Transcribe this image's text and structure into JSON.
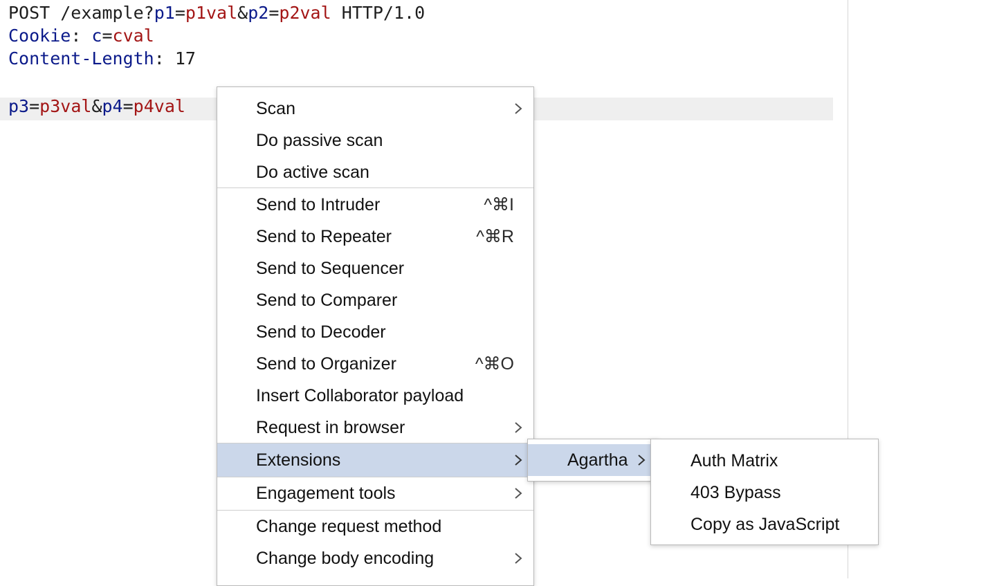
{
  "editor": {
    "request_line": {
      "method_path": "POST /example?",
      "p1_key": "p1",
      "eq1": "=",
      "p1_val": "p1val",
      "amp1": "&",
      "p2_key": "p2",
      "eq2": "=",
      "p2_val": "p2val",
      "protocol": " HTTP/1.0"
    },
    "cookie_line": {
      "name": "Cookie",
      "sep": ": ",
      "key": "c",
      "eq": "=",
      "val": "cval"
    },
    "content_length_line": {
      "name": "Content-Length",
      "sep": ": ",
      "val": "17"
    },
    "body_line": {
      "p3_key": "p3",
      "eq1": "=",
      "p3_val": "p3val",
      "amp": "&",
      "p4_key": "p4",
      "eq2": "=",
      "p4_val": "p4val"
    }
  },
  "context_menu": {
    "items": [
      {
        "label": "Scan",
        "submenu": true
      },
      {
        "label": "Do passive scan"
      },
      {
        "label": "Do active scan"
      },
      {
        "label": "Send to Intruder",
        "shortcut": "^⌘I"
      },
      {
        "label": "Send to Repeater",
        "shortcut": "^⌘R"
      },
      {
        "label": "Send to Sequencer"
      },
      {
        "label": "Send to Comparer"
      },
      {
        "label": "Send to Decoder"
      },
      {
        "label": "Send to Organizer",
        "shortcut": "^⌘O"
      },
      {
        "label": "Insert Collaborator payload"
      },
      {
        "label": "Request in browser",
        "submenu": true
      },
      {
        "label": "Extensions",
        "submenu": true,
        "selected": true
      },
      {
        "label": "Engagement tools",
        "submenu": true
      },
      {
        "label": "Change request method"
      },
      {
        "label": "Change body encoding",
        "submenu": true
      }
    ]
  },
  "extensions_submenu": {
    "items": [
      {
        "label": "Agartha",
        "submenu": true,
        "selected": true
      }
    ]
  },
  "agartha_submenu": {
    "items": [
      {
        "label": "Auth Matrix"
      },
      {
        "label": "403 Bypass"
      },
      {
        "label": "Copy as JavaScript"
      }
    ]
  },
  "colors": {
    "selection": "#cbd7ea",
    "header_name": "#0b1a8a",
    "param_value": "#a31515",
    "line_highlight": "#efefef"
  },
  "icons": {
    "submenu_arrow": "chevron-right-icon"
  }
}
